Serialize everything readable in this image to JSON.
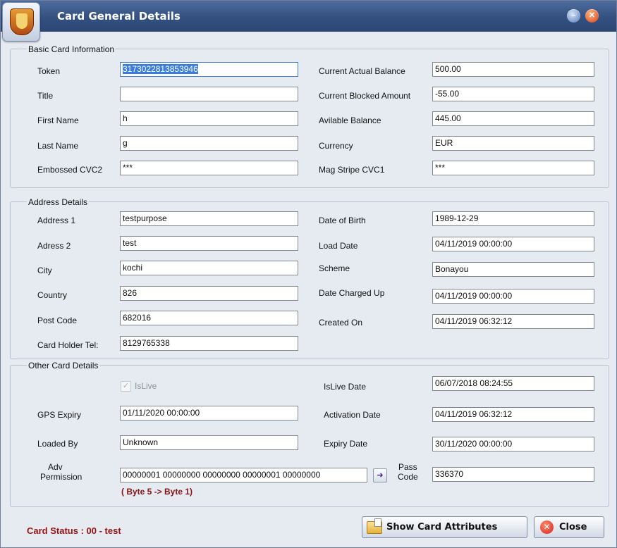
{
  "window": {
    "title": "Card General Details"
  },
  "sections": {
    "basic": "Basic Card Information",
    "address": "Address Details",
    "other": "Other Card Details"
  },
  "basic_left": [
    {
      "label": "Token",
      "value": "3173022813853946"
    },
    {
      "label": "Title",
      "value": ""
    },
    {
      "label": "First Name",
      "value": "h"
    },
    {
      "label": "Last Name",
      "value": "g"
    },
    {
      "label": "Embossed  CVC2",
      "value": "***"
    }
  ],
  "basic_right": [
    {
      "label": "Current Actual Balance",
      "value": "500.00"
    },
    {
      "label": "Current Blocked Amount",
      "value": "-55.00"
    },
    {
      "label": "Avilable Balance",
      "value": "445.00"
    },
    {
      "label": "Currency",
      "value": "EUR"
    },
    {
      "label": "Mag Stripe CVC1",
      "value": "***"
    }
  ],
  "address_left": [
    {
      "label": "Address 1",
      "value": "testpurpose"
    },
    {
      "label": "Adress 2",
      "value": "test"
    },
    {
      "label": "City",
      "value": "kochi"
    },
    {
      "label": "Country",
      "value": "826"
    },
    {
      "label": "Post Code",
      "value": "682016"
    },
    {
      "label": "Card Holder Tel:",
      "value": "8129765338"
    }
  ],
  "address_right": [
    {
      "label": "Date of Birth",
      "value": "1989-12-29"
    },
    {
      "label": "Load Date",
      "value": "04/11/2019 00:00:00"
    },
    {
      "label": "Scheme",
      "value": "Bonayou"
    },
    {
      "label": "Date Charged Up",
      "value": "04/11/2019 00:00:00"
    },
    {
      "label": "Created On",
      "value": "04/11/2019 06:32:12"
    }
  ],
  "other": {
    "islive_label": "IsLive",
    "islive_checked": true,
    "islive_date_label": "IsLive Date",
    "islive_date": "06/07/2018 08:24:55",
    "gps_expiry_label": "GPS Expiry",
    "gps_expiry": "01/11/2020 00:00:00",
    "activation_label": "Activation Date",
    "activation_date": "04/11/2019 06:32:12",
    "loaded_by_label": "Loaded By",
    "loaded_by": "Unknown",
    "expiry_label": "Expiry Date",
    "expiry_date": "30/11/2020 00:00:00",
    "adv_label_1": "Adv",
    "adv_label_2": "Permission",
    "adv_permission": "00000001 00000000 00000000 00000001 00000000",
    "byte_hint": "( Byte 5 -> Byte 1)",
    "pass_label_1": "Pass",
    "pass_label_2": "Code",
    "pass_code": "336370"
  },
  "footer": {
    "status": "Card Status : 00  - test",
    "show_attributes": "Show Card Attributes",
    "close": "Close"
  },
  "colors": {
    "titlebar": "#33507f",
    "status": "#9a1212",
    "body": "#e6eaf1"
  },
  "icons": {
    "app": "card-shield-icon",
    "minimize": "minimize-icon",
    "close": "close-icon",
    "folder": "folder-icon",
    "arrow": "arrow-right-icon"
  }
}
